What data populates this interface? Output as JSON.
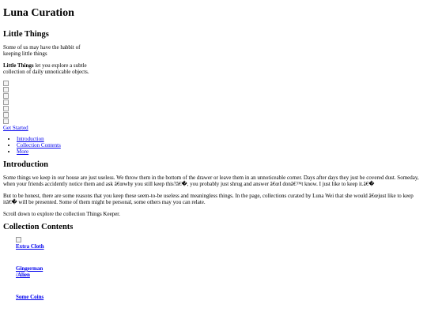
{
  "site": {
    "title": "Luna Curation"
  },
  "hero": {
    "heading": "Little Things",
    "intro": "Some of us may have the habbit of keeping little things",
    "desc_strong": "Little Things",
    "desc_rest": " let you explore a subtle collection of daily unnoticable objects.",
    "image_count": 7,
    "cta_label": "Get Started"
  },
  "nav": {
    "items": [
      {
        "label": "Introduction"
      },
      {
        "label": "Collection Contents"
      },
      {
        "label": "More"
      }
    ]
  },
  "introduction": {
    "heading": "Introduction",
    "p1": "Some things we keep in our house are just useless. We throw them in the bottom of the drawer or leave them in an unnoticeable corner. Days after days they just be covered dust. Someday, when your friends accidently notice them and ask â€œwhy you still keep this?â€�, you probably just shrug and answer â€œI donâ€™t know. I just like to keep it.â€�",
    "p2": "But to be honest, there are some reasons that you keep these seem-to-be useless and meaningless things. In the page, collections curated by Luna Wei that she would â€œjust like to keep itâ€� will be presented. Some of them might be personal, some others may you can relate.",
    "p3": "Scroll down to explore the collection Things Keeper."
  },
  "collection": {
    "heading": "Collection Contents",
    "items": [
      {
        "label": "Extra Cloth"
      },
      {
        "label": "Gingerman /Alien"
      },
      {
        "label": "Some Coins"
      }
    ]
  }
}
